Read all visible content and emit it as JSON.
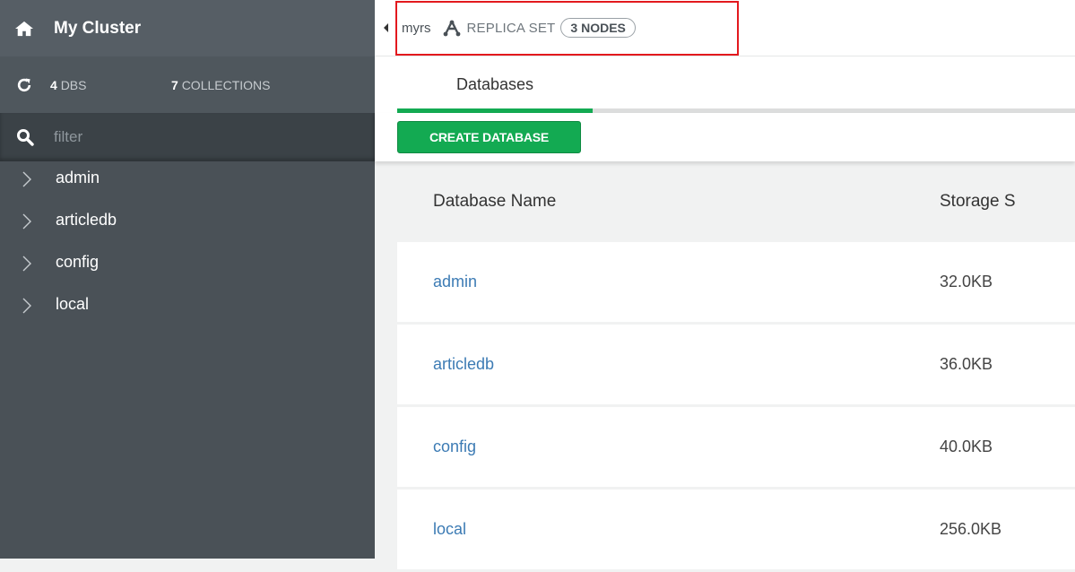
{
  "sidebar": {
    "cluster_name": "My Cluster",
    "stats": {
      "dbs_count": "4",
      "dbs_label": "DBS",
      "collections_count": "7",
      "collections_label": "COLLECTIONS"
    },
    "filter_placeholder": "filter",
    "databases": [
      "admin",
      "articledb",
      "config",
      "local"
    ]
  },
  "topbar": {
    "replica_set_name": "myrs",
    "topology_label": "REPLICA SET",
    "nodes_badge": "3 NODES"
  },
  "tabs": {
    "active": "Databases"
  },
  "toolbar": {
    "create_database_label": "CREATE DATABASE"
  },
  "table": {
    "headers": {
      "name": "Database Name",
      "size": "Storage S"
    },
    "rows": [
      {
        "name": "admin",
        "size": "32.0KB"
      },
      {
        "name": "articledb",
        "size": "36.0KB"
      },
      {
        "name": "config",
        "size": "40.0KB"
      },
      {
        "name": "local",
        "size": "256.0KB"
      }
    ]
  },
  "colors": {
    "sidebar_bg": "#4a5157",
    "accent_green": "#13aa52",
    "link_blue": "#3c7bb4",
    "highlight_red": "#e3191e"
  },
  "icons": [
    "home-icon",
    "refresh-icon",
    "search-icon",
    "chevron-right-icon",
    "caret-left-icon",
    "replica-set-icon"
  ]
}
